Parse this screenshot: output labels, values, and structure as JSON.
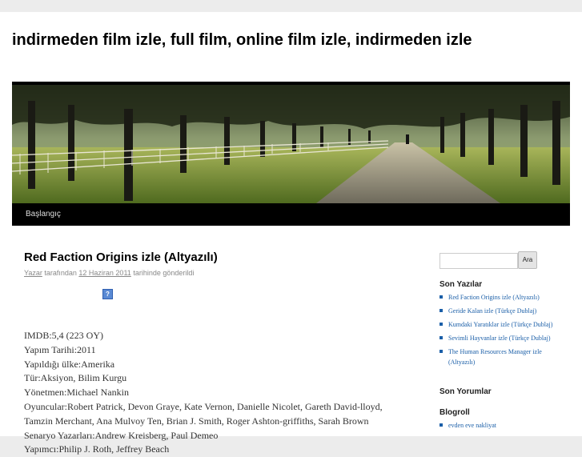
{
  "site": {
    "title": "indirmeden film izle, full film, online film izle, indirmeden izle"
  },
  "nav": {
    "items": [
      {
        "label": "Başlangıç"
      }
    ]
  },
  "post": {
    "title": "Red Faction Origins izle (Altyazılı)",
    "meta": {
      "author": "Yazar",
      "by_text": "tarafından",
      "date": "12 Haziran 2011",
      "posted_text": "tarihinde gönderildi"
    },
    "lines": [
      "IMDB:5,4 (223 OY)",
      "Yapım Tarihi:2011",
      "Yapıldığı ülke:Amerika",
      "Tür:Aksiyon, Bilim Kurgu",
      "Yönetmen:Michael Nankin",
      "Oyuncular:Robert Patrick, Devon Graye, Kate Vernon, Danielle Nicolet, Gareth David-lloyd, Tamzin Merchant, Ana Mulvoy Ten, Brian J. Smith, Roger Ashton-griffiths, Sarah Brown",
      "Senaryo Yazarları:Andrew Kreisberg, Paul Demeo",
      "Yapımcı:Philip J. Roth, Jeffrey Beach"
    ]
  },
  "sidebar": {
    "search_button": "Ara",
    "recent_posts_title": "Son Yazılar",
    "recent_posts": [
      "Red Faction Origins izle (Altyazılı)",
      "Geride Kalan izle (Türkçe Dublaj)",
      "Kumdaki Yaratıklar izle (Türkçe Dublaj)",
      "Sevimli Hayvanlar izle (Türkçe Dublaj)",
      "The Human Resources Manager izle (Altyazılı)"
    ],
    "recent_comments_title": "Son Yorumlar",
    "blogroll_title": "Blogroll",
    "blogroll": [
      "evden eve nakliyat"
    ]
  },
  "colors": {
    "link": "#1b5fa8",
    "nav_bg": "#000000",
    "page_bg": "#ececec"
  }
}
